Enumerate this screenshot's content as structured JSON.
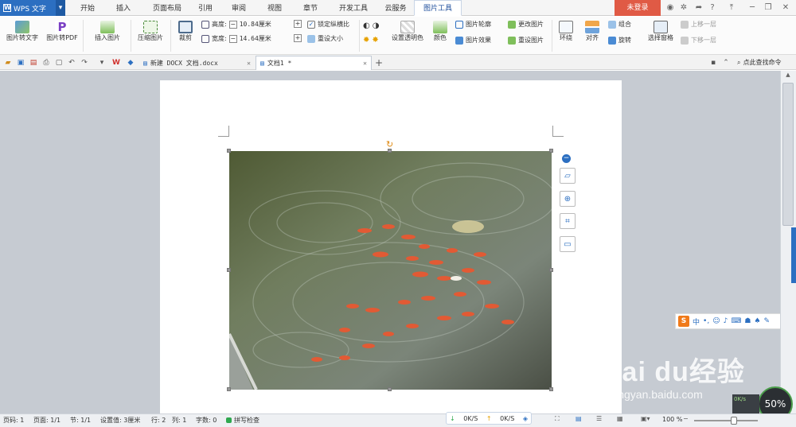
{
  "app": {
    "name": "WPS 文字"
  },
  "menu_tabs": [
    "开始",
    "插入",
    "页面布局",
    "引用",
    "审阅",
    "视图",
    "章节",
    "开发工具",
    "云服务",
    "图片工具"
  ],
  "active_tab": "图片工具",
  "login_label": "未登录",
  "titlebar_help": "?",
  "ribbon": {
    "pic_to_text": "图片转文字",
    "pic_to_pdf": "图片转PDF",
    "insert_pic": "插入图片",
    "compress": "压缩图片",
    "crop": "裁剪",
    "height_label": "高度:",
    "height_value": "10.84厘米",
    "width_label": "宽度:",
    "width_value": "14.64厘米",
    "minus": "−",
    "plus": "+",
    "lock_ratio": "锁定纵横比",
    "reset_size": "重设大小",
    "set_transparent": "设置透明色",
    "color": "颜色",
    "pic_outline": "图片轮廓",
    "pic_effect": "图片效果",
    "change_pic": "更改图片",
    "reset_pic": "重设图片",
    "wrap": "环绕",
    "align": "对齐",
    "group": "组合",
    "rotate": "旋转",
    "select_pane": "选择窗格",
    "bring_forward": "上移一层",
    "send_backward": "下移一层"
  },
  "doc_tabs": [
    {
      "label": "新建 DOCX 文档.docx",
      "active": false
    },
    {
      "label": "文档1 *",
      "active": true
    }
  ],
  "search_command": "点此查找命令",
  "sogou_bar": {
    "logo": "S",
    "mode": "中"
  },
  "watermark": {
    "main": "Bai du经验",
    "sub": "jingyan.baidu.com"
  },
  "speed_widget": {
    "percent": "50%",
    "rate": "0K/s"
  },
  "net_widget": {
    "down": "0K/S",
    "up": "0K/S"
  },
  "status": {
    "page_no": "页码: 1",
    "pages": "页面: 1/1",
    "section": "节: 1/1",
    "setting": "设置值: 3厘米",
    "row": "行: 2",
    "col": "列: 1",
    "words": "字数: 0",
    "spell": "拼写检查",
    "zoom": "100 %"
  },
  "colors": {
    "accent": "#2c6fc1",
    "login": "#e05a45",
    "workspace": "#c6cbd2"
  }
}
